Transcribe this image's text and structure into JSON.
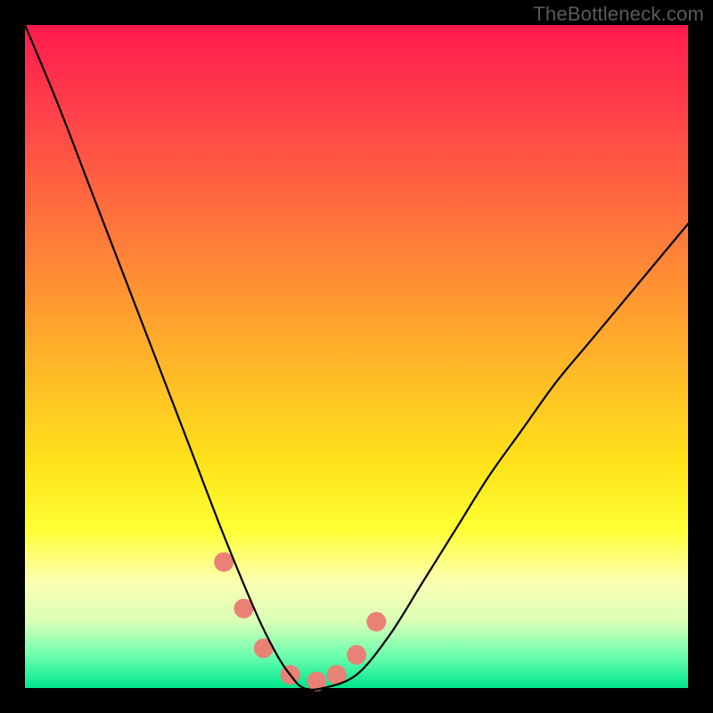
{
  "watermark": "TheBottleneck.com",
  "colors": {
    "frame": "#000000",
    "gradient_top": "#ff1a4e",
    "gradient_bottom": "#00e68c",
    "curve": "#000000",
    "markers": "#e98176"
  },
  "chart_data": {
    "type": "line",
    "title": "",
    "xlabel": "",
    "ylabel": "",
    "xlim": [
      0,
      1
    ],
    "ylim": [
      0,
      1
    ],
    "series": [
      {
        "name": "bottleneck-curve",
        "x": [
          0.0,
          0.05,
          0.1,
          0.15,
          0.2,
          0.25,
          0.3,
          0.35,
          0.38,
          0.4,
          0.42,
          0.45,
          0.5,
          0.55,
          0.6,
          0.65,
          0.7,
          0.75,
          0.8,
          0.85,
          0.9,
          0.95,
          1.0
        ],
        "y": [
          1.0,
          0.88,
          0.75,
          0.62,
          0.49,
          0.36,
          0.23,
          0.11,
          0.05,
          0.02,
          0.0,
          0.0,
          0.02,
          0.08,
          0.16,
          0.24,
          0.32,
          0.39,
          0.46,
          0.52,
          0.58,
          0.64,
          0.7
        ]
      }
    ],
    "markers": {
      "name": "highlighted-points",
      "x": [
        0.3,
        0.33,
        0.36,
        0.4,
        0.44,
        0.47,
        0.5,
        0.53
      ],
      "y": [
        0.19,
        0.12,
        0.06,
        0.02,
        0.01,
        0.02,
        0.05,
        0.1
      ]
    }
  }
}
